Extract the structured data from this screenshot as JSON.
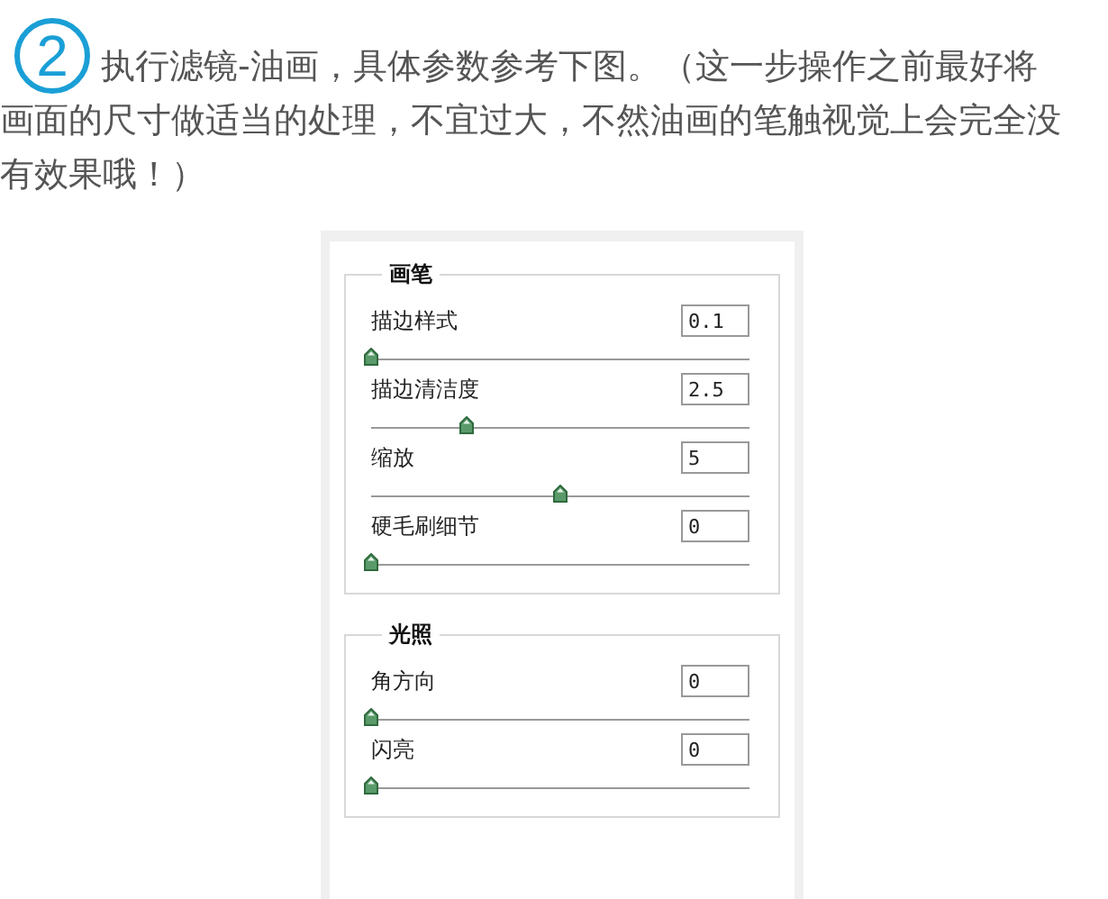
{
  "step_number": "2",
  "instruction": [
    "执行滤镜-油画，具体参数参考下图。（这一步操作之前最好将",
    "画面的尺寸做适当的处理，不宜过大，不然油画的笔触视觉上会完全没有效果哦！）"
  ],
  "dialog": {
    "groups": [
      {
        "title": "画笔",
        "params": [
          {
            "label": "描边样式",
            "value": "0.1",
            "level": 0
          },
          {
            "label": "描边清洁度",
            "value": "2.5",
            "level": 0.25
          },
          {
            "label": "缩放",
            "value": "5",
            "level": 0.5
          },
          {
            "label": "硬毛刷细节",
            "value": "0",
            "level": 0
          }
        ]
      },
      {
        "title": "光照",
        "params": [
          {
            "label": "角方向",
            "value": "0",
            "level": 0
          },
          {
            "label": "闪亮",
            "value": "0",
            "level": 0
          }
        ]
      }
    ]
  }
}
